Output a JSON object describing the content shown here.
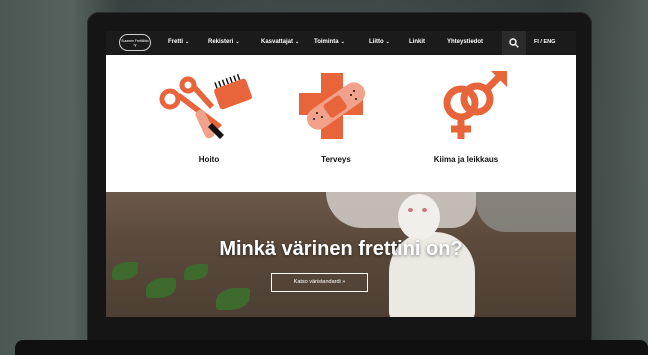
{
  "nav": {
    "logo_text": "Suomen Frettiliitto ry",
    "items": [
      {
        "label": "Fretti",
        "has_dropdown": true
      },
      {
        "label": "Rekisteri",
        "has_dropdown": true
      },
      {
        "label": "Kasvattajat",
        "has_dropdown": true
      },
      {
        "label": "Toiminta",
        "has_dropdown": true
      },
      {
        "label": "Liitto",
        "has_dropdown": true
      },
      {
        "label": "Linkit",
        "has_dropdown": false
      },
      {
        "label": "Yhteystiedot",
        "has_dropdown": false
      }
    ],
    "search_icon": "search-icon",
    "language": "FI / ENG"
  },
  "features": [
    {
      "label": "Hoito",
      "icon": "grooming-scissors-brush-icon"
    },
    {
      "label": "Terveys",
      "icon": "health-cross-bandage-icon"
    },
    {
      "label": "Kiima ja leikkaus",
      "icon": "gender-symbols-icon"
    }
  ],
  "hero": {
    "title": "Minkä värinen frettini on?",
    "button_label": "Katso väristandardi »"
  },
  "colors": {
    "accent_orange": "#e8643a",
    "accent_peach": "#f2a28a",
    "nav_bg": "#1b1b1b"
  }
}
